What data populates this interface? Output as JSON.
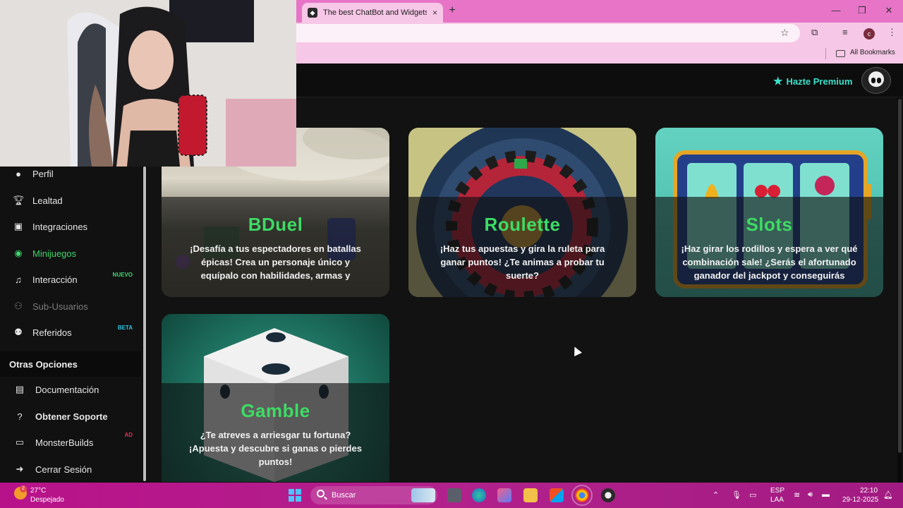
{
  "browser": {
    "tab_title": "The best ChatBot and Widgets",
    "tab_close": "×",
    "new_tab": "+",
    "window_controls": [
      "—",
      "❐",
      "✕"
    ],
    "profile_initial": "c",
    "bookmarks_label": "All Bookmarks"
  },
  "header": {
    "premium_label": "Hazte Premium"
  },
  "sidebar": {
    "items": [
      {
        "label": "Perfil",
        "icon": "user-icon"
      },
      {
        "label": "Lealtad",
        "icon": "trophy-icon"
      },
      {
        "label": "Integraciones",
        "icon": "integrations-icon"
      },
      {
        "label": "Minijuegos",
        "icon": "gamepad-icon",
        "active": true
      },
      {
        "label": "Interacción",
        "icon": "music-icon",
        "badge": "NUEVO"
      },
      {
        "label": "Sub-Usuarios",
        "icon": "users-icon",
        "muted": true
      },
      {
        "label": "Referidos",
        "icon": "referrals-icon",
        "badge": "BETA"
      }
    ],
    "section_title": "Otras Opciones",
    "options": [
      {
        "label": "Documentación",
        "icon": "docs-icon"
      },
      {
        "label": "Obtener Soporte",
        "icon": "help-icon"
      },
      {
        "label": "MonsterBuilds",
        "icon": "laptop-icon",
        "badge": "AD"
      },
      {
        "label": "Cerrar Sesión",
        "icon": "logout-icon"
      }
    ],
    "colors": {
      "active": "#3ed66c",
      "badge_new": "#3ed66c",
      "badge_beta": "#2fc4e0",
      "badge_ad": "#e0335a"
    }
  },
  "games": [
    {
      "title": "BDuel",
      "description": "¡Desafía a tus espectadores en batallas épicas! Crea un personaje único y equípalo con habilidades, armas y"
    },
    {
      "title": "Roulette",
      "description": "¡Haz tus apuestas y gira la ruleta para ganar puntos! ¿Te animas a probar tu suerte?"
    },
    {
      "title": "Slots",
      "description": "¡Haz girar los rodillos y espera a ver qué combinación sale! ¿Serás el afortunado ganador del jackpot y conseguirás"
    },
    {
      "title": "Gamble",
      "description": "¿Te atreves a arriesgar tu fortuna? ¡Apuesta y descubre si ganas o pierdes puntos!"
    }
  ],
  "taskbar": {
    "temperature": "27°C",
    "weather": "Despejado",
    "weather_badge": "2",
    "search_placeholder": "Buscar",
    "language": "ESP",
    "layout": "LAA",
    "time": "22:10",
    "date": "29-12-2025"
  },
  "accent": {
    "title_green": "#3ddc63",
    "premium_teal": "#3ce0c9",
    "taskbar": "#b8128a"
  }
}
